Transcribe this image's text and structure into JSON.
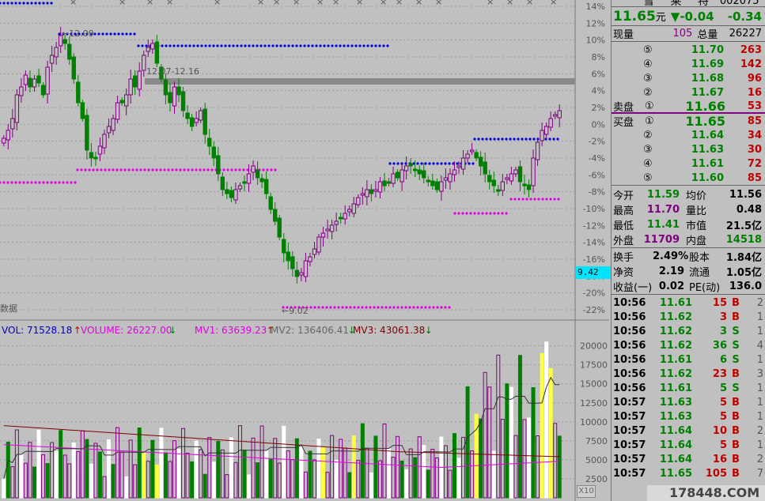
{
  "header": {
    "code": "002075",
    "price": "11.65",
    "price_unit": "元",
    "change": "▼-0.04",
    "change2": "-0.34"
  },
  "chart_data": [
    {
      "type": "candlestick",
      "y_axis_right": [
        "14%",
        "12%",
        "10%",
        "8%",
        "6%",
        "4%",
        "2%",
        "0%",
        "-2%",
        "-4%",
        "-6%",
        "-8%",
        "-10%",
        "-12%",
        "-14%",
        "-16%",
        "-18%",
        "-20%",
        "-22%"
      ],
      "annotations": {
        "high_label": "12.09",
        "low_label": "9.02",
        "range_label": "12.07-12.16",
        "cursor_price": "9.42",
        "left_label": "数据"
      },
      "ylim": [
        -22,
        14
      ]
    },
    {
      "type": "bar",
      "legend": {
        "vol": "VOL: 71528.18",
        "volume": "VOLUME: 26227.00",
        "mv1": "MV1: 63639.23",
        "mv2": "MV2: 136406.41",
        "mv3": "MV3: 43061.38"
      },
      "y_axis_right": [
        "20000",
        "17500",
        "15000",
        "12500",
        "10000",
        "7500",
        "5000",
        "2500"
      ],
      "ylim": [
        0,
        21000
      ],
      "x10": "X10"
    }
  ],
  "quote": {
    "labels": {
      "now_vol": "现量",
      "total_vol": "总量",
      "sell": "卖盘",
      "buy": "买盘"
    },
    "now_vol": "105",
    "total_vol": "26227",
    "sells": [
      {
        "idx": "⑤",
        "price": "11.70",
        "vol": "263"
      },
      {
        "idx": "④",
        "price": "11.69",
        "vol": "142"
      },
      {
        "idx": "③",
        "price": "11.68",
        "vol": "96"
      },
      {
        "idx": "②",
        "price": "11.67",
        "vol": "16"
      },
      {
        "idx": "①",
        "price": "11.66",
        "vol": "53"
      }
    ],
    "buys": [
      {
        "idx": "①",
        "price": "11.65",
        "vol": "85"
      },
      {
        "idx": "②",
        "price": "11.64",
        "vol": "34"
      },
      {
        "idx": "③",
        "price": "11.63",
        "vol": "30"
      },
      {
        "idx": "④",
        "price": "11.61",
        "vol": "72"
      },
      {
        "idx": "⑤",
        "price": "11.60",
        "vol": "85"
      }
    ],
    "stats": [
      {
        "l1": "今开",
        "v1": "11.59",
        "l2": "均价",
        "v2": "11.56"
      },
      {
        "l1": "最高",
        "v1": "11.70",
        "l2": "量比",
        "v2": "0.48"
      },
      {
        "l1": "最低",
        "v1": "11.41",
        "l2": "市值",
        "v2": "21.5亿"
      },
      {
        "l1": "外盘",
        "v1": "11709",
        "l2": "内盘",
        "v2": "14518"
      }
    ],
    "stats2": [
      {
        "l1": "换手",
        "v1": "2.49%",
        "l2": "股本",
        "v2": "1.84亿"
      },
      {
        "l1": "净资",
        "v1": "2.19",
        "l2": "流通",
        "v2": "1.05亿"
      },
      {
        "l1": "收益(一)",
        "v1": "0.02",
        "l2": "PE(动)",
        "v2": "136.0"
      }
    ],
    "ticks": [
      {
        "t": "10:56",
        "p": "11.61",
        "v": "15",
        "s": "B",
        "n": "2"
      },
      {
        "t": "10:56",
        "p": "11.62",
        "v": "3",
        "s": "B",
        "n": "1"
      },
      {
        "t": "10:56",
        "p": "11.62",
        "v": "3",
        "s": "S",
        "n": "1"
      },
      {
        "t": "10:56",
        "p": "11.62",
        "v": "36",
        "s": "S",
        "n": "4"
      },
      {
        "t": "10:56",
        "p": "11.61",
        "v": "6",
        "s": "S",
        "n": "1"
      },
      {
        "t": "10:56",
        "p": "11.62",
        "v": "23",
        "s": "B",
        "n": "3"
      },
      {
        "t": "10:56",
        "p": "11.61",
        "v": "5",
        "s": "S",
        "n": "1"
      },
      {
        "t": "10:57",
        "p": "11.63",
        "v": "5",
        "s": "B",
        "n": "1"
      },
      {
        "t": "10:57",
        "p": "11.63",
        "v": "5",
        "s": "B",
        "n": "1"
      },
      {
        "t": "10:57",
        "p": "11.64",
        "v": "10",
        "s": "B",
        "n": "2"
      },
      {
        "t": "10:57",
        "p": "11.64",
        "v": "5",
        "s": "B",
        "n": "1"
      },
      {
        "t": "10:57",
        "p": "11.64",
        "v": "16",
        "s": "B",
        "n": "2"
      },
      {
        "t": "10:57",
        "p": "11.65",
        "v": "105",
        "s": "B",
        "n": "7"
      }
    ]
  },
  "watermark": "178448.COM",
  "colors": {
    "up": "#800080",
    "down": "#008000",
    "buy_tick": "#c00000",
    "sell_tick": "#008000",
    "cursor_box": "#00e5ff"
  }
}
